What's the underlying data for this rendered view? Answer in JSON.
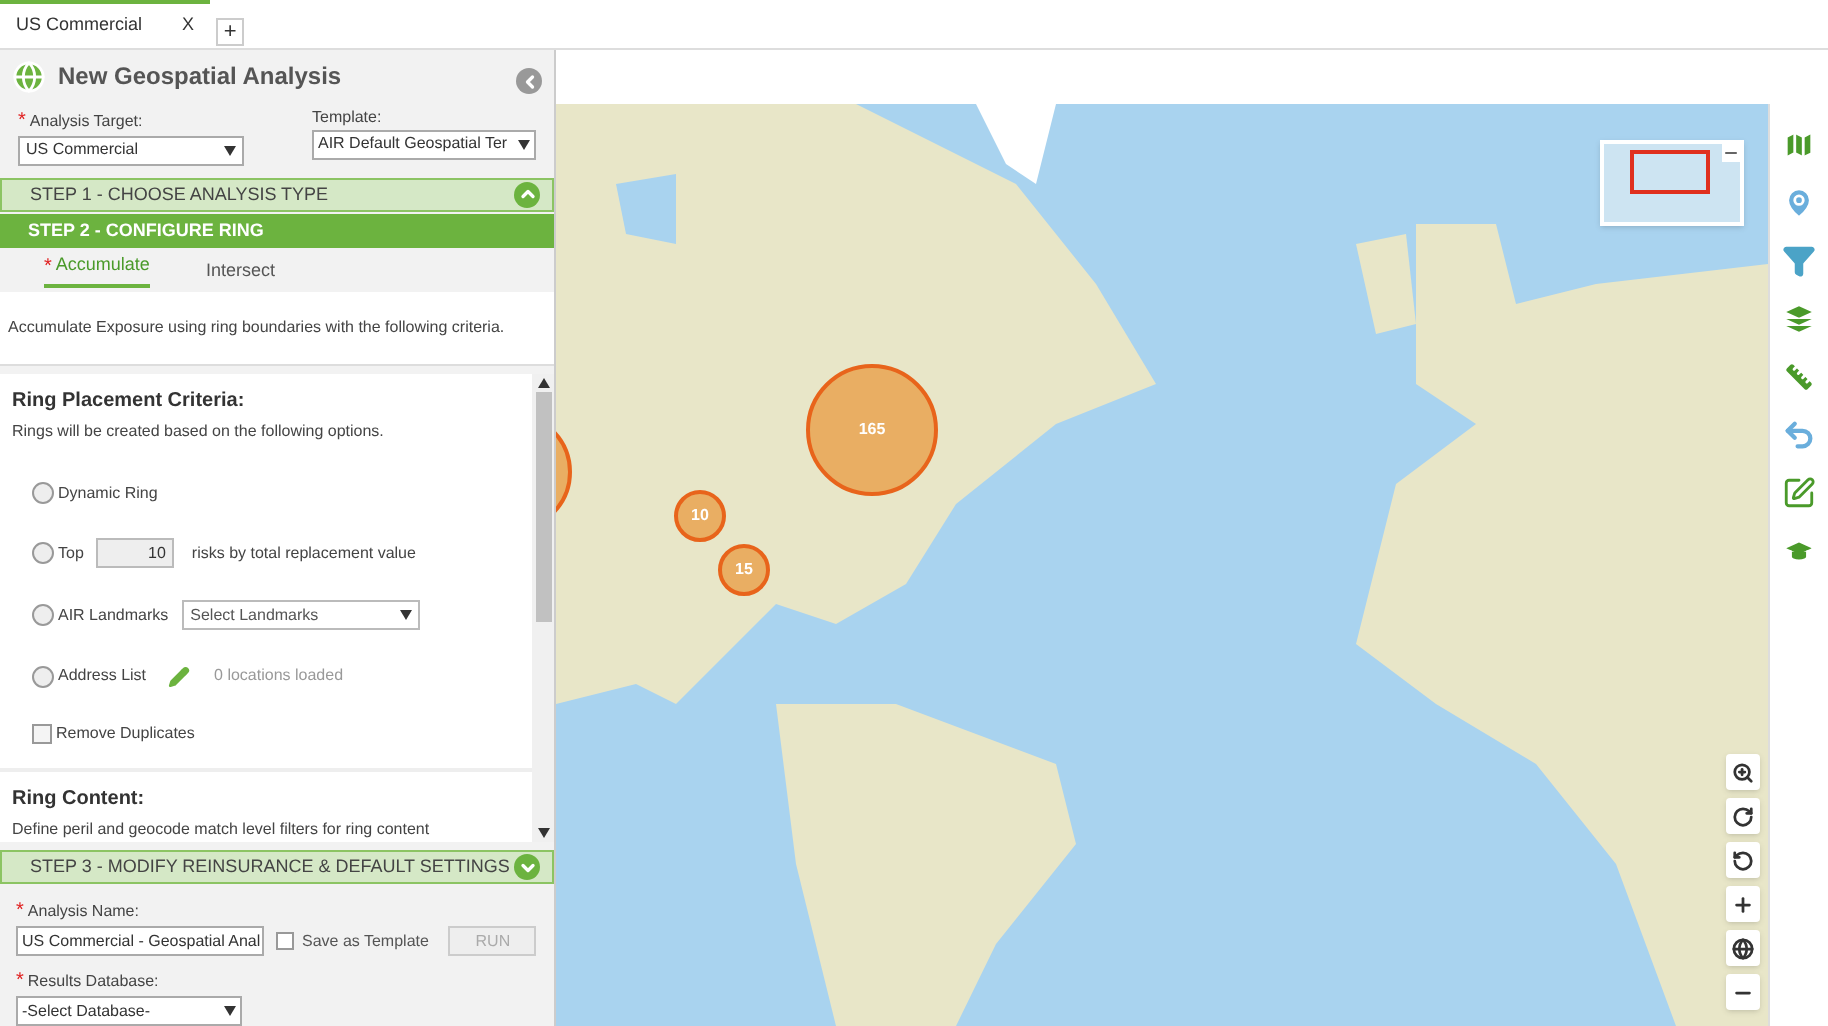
{
  "tabs": [
    {
      "label": "US Commercial",
      "close": "X",
      "selected": true
    }
  ],
  "add_tab": "+",
  "panel": {
    "title": "New Geospatial Analysis",
    "analysis_target": {
      "label": "Analysis Target:",
      "required": true,
      "value": "US Commercial"
    },
    "template": {
      "label": "Template:",
      "value": "AIR Default Geospatial Ter"
    },
    "steps": [
      {
        "label": "STEP 1 - CHOOSE ANALYSIS TYPE",
        "kind": "collapse"
      },
      {
        "label": "STEP 2 - CONFIGURE RING",
        "kind": "current"
      },
      {
        "label": "STEP 3 - MODIFY REINSURANCE & DEFAULT SETTINGS",
        "kind": "expand"
      }
    ],
    "sub_tabs": [
      {
        "label": "Accumulate",
        "selected": true,
        "required": true
      },
      {
        "label": "Intersect",
        "selected": false,
        "required": false
      }
    ],
    "description": "Accumulate Exposure using ring boundaries with the following criteria.",
    "ring_placement": {
      "heading": "Ring Placement Criteria:",
      "subtitle": "Rings will be created based on the following options.",
      "options": [
        {
          "kind": "radio",
          "label": "Dynamic Ring",
          "checked": false
        },
        {
          "kind": "radio-number",
          "label": "Top",
          "value": "10",
          "suffix": "risks by total replacement value",
          "checked": false
        },
        {
          "kind": "radio-select",
          "label": "AIR Landmarks",
          "value": "Select Landmarks",
          "checked": false
        },
        {
          "kind": "radio-edit",
          "label": "Address List",
          "note": "0 locations loaded",
          "checked": false
        },
        {
          "kind": "checkbox",
          "label": "Remove Duplicates",
          "checked": false
        }
      ]
    },
    "ring_content": {
      "heading": "Ring Content:",
      "subtitle": "Define peril and geocode match level filters for ring content"
    },
    "settings": {
      "analysis_name": {
        "label": "Analysis Name:",
        "required": true,
        "value": "US Commercial - Geospatial Anal"
      },
      "save_as_template": {
        "label": "Save as Template",
        "checked": false
      },
      "run": {
        "label": "RUN",
        "disabled": true
      },
      "results_database": {
        "label": "Results Database:",
        "required": true,
        "value": "-Select Database-"
      }
    }
  },
  "required_mark": "*",
  "map": {
    "clusters": [
      {
        "kind": "large"
      },
      {
        "kind": "large",
        "label": "165"
      },
      {
        "kind": "small",
        "label": "10"
      },
      {
        "kind": "small",
        "label": "15"
      }
    ]
  }
}
